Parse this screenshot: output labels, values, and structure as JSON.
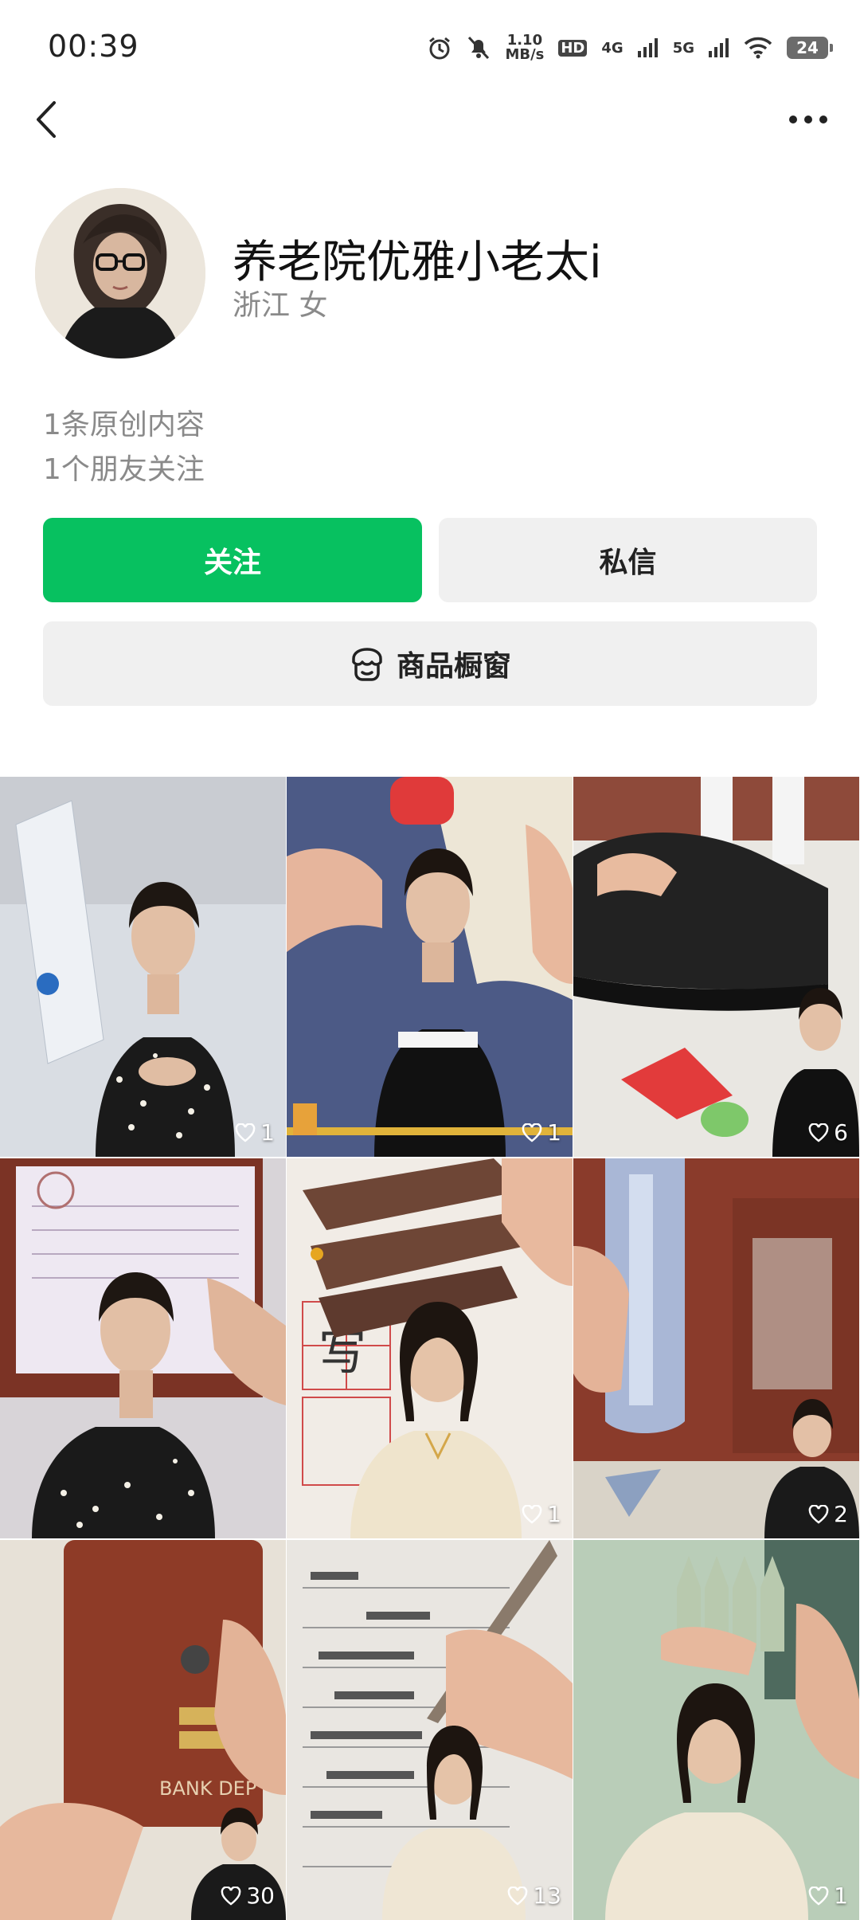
{
  "status_bar": {
    "time": "00:39",
    "net_speed_value": "1.10",
    "net_speed_unit": "MB/s",
    "hd_label": "HD",
    "signal_4g": "4G",
    "signal_5g": "5G",
    "battery": "24"
  },
  "profile": {
    "name": "养老院优雅小老太i",
    "location": "浙江 女",
    "original_content": "1条原创内容",
    "friends_following": "1个朋友关注"
  },
  "actions": {
    "follow_label": "关注",
    "message_label": "私信",
    "shop_label": "商品橱窗"
  },
  "colors": {
    "follow_green": "#07c160",
    "secondary_button": "#f0f0f0"
  },
  "videos": [
    {
      "likes": "1",
      "theme": "bank-folder"
    },
    {
      "likes": "1",
      "theme": "glue-tube"
    },
    {
      "likes": "6",
      "theme": "shoe-repair"
    },
    {
      "likes": "",
      "theme": "bank-receipt"
    },
    {
      "likes": "1",
      "theme": "pens"
    },
    {
      "likes": "2",
      "theme": "blue-cover"
    },
    {
      "likes": "30",
      "theme": "leather-folder"
    },
    {
      "likes": "13",
      "theme": "homework"
    },
    {
      "likes": "1",
      "theme": "green-pens"
    }
  ]
}
